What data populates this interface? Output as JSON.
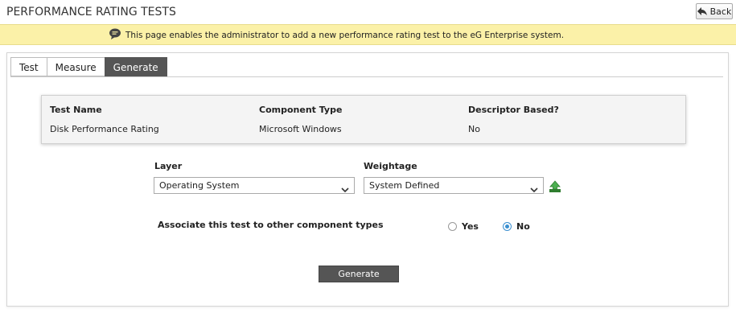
{
  "header": {
    "title": "PERFORMANCE RATING TESTS",
    "back_label": "Back"
  },
  "info": {
    "message": "This page enables the administrator to add a new performance rating test to the eG Enterprise system."
  },
  "tabs": [
    {
      "label": "Test",
      "active": false
    },
    {
      "label": "Measure",
      "active": false
    },
    {
      "label": "Generate",
      "active": true
    }
  ],
  "summary": {
    "test_name_label": "Test Name",
    "test_name_value": "Disk Performance Rating",
    "component_type_label": "Component Type",
    "component_type_value": "Microsoft Windows",
    "descriptor_label": "Descriptor Based?",
    "descriptor_value": "No"
  },
  "form": {
    "layer_label": "Layer",
    "layer_value": "Operating System",
    "weightage_label": "Weightage",
    "weightage_value": "System Defined",
    "associate_label": "Associate this test to other component types",
    "yes_label": "Yes",
    "no_label": "No",
    "associate_selected": "No",
    "generate_label": "Generate"
  },
  "colors": {
    "info_bar": "#fbf1a8",
    "active_tab": "#555555",
    "radio_accent": "#3a8fd0",
    "upload_icon": "#3a9a3a"
  }
}
